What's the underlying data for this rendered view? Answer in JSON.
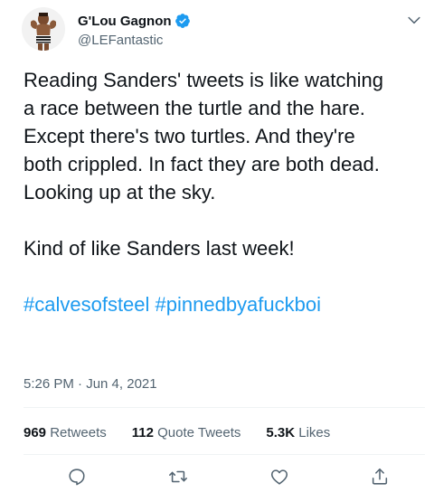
{
  "author": {
    "display_name": "G'Lou Gagnon",
    "handle": "@LEFantastic",
    "verified": true
  },
  "tweet": {
    "lines": [
      "Reading Sanders' tweets is like watching",
      "a race between the turtle and the hare.",
      "Except there's two turtles. And they're",
      "both crippled. In fact they are both dead.",
      "Looking up at the sky."
    ],
    "line2": "Kind of like Sanders last week!",
    "hashtags": "#calvesofsteel #pinnedbyafuckboi",
    "timestamp": "5:26 PM · Jun 4, 2021"
  },
  "stats": {
    "retweets_count": "969",
    "retweets_label": "Retweets",
    "quotes_count": "112",
    "quotes_label": "Quote Tweets",
    "likes_count": "5.3K",
    "likes_label": "Likes"
  },
  "icons": {
    "more": "chevron-down-icon",
    "reply": "reply-icon",
    "retweet": "retweet-icon",
    "like": "heart-icon",
    "share": "share-icon"
  },
  "colors": {
    "accent": "#1d9bf0",
    "text": "#0f1419",
    "secondary": "#536471"
  }
}
